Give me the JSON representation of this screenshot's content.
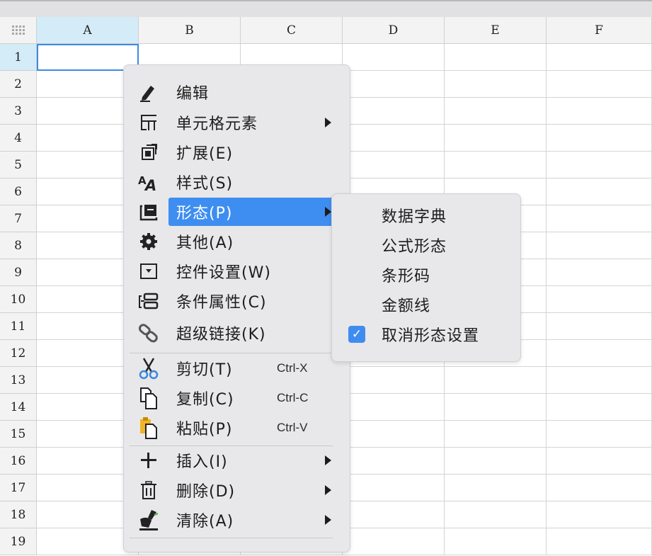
{
  "spreadsheet": {
    "columns": [
      "A",
      "B",
      "C",
      "D",
      "E",
      "F"
    ],
    "rows": [
      "1",
      "2",
      "3",
      "4",
      "5",
      "6",
      "7",
      "8",
      "9",
      "10",
      "11",
      "12",
      "13",
      "14",
      "15",
      "16",
      "17",
      "18",
      "19"
    ],
    "selected_cell": "A1"
  },
  "context_menu": {
    "items": [
      {
        "label": "编辑",
        "icon": "pencil-icon"
      },
      {
        "label": "单元格元素",
        "icon": "cell-element-icon",
        "submenu": true
      },
      {
        "label": "扩展(E)",
        "icon": "expand-icon"
      },
      {
        "label": "样式(S)",
        "icon": "style-icon"
      },
      {
        "label": "形态(P)",
        "icon": "form-icon",
        "submenu": true,
        "highlighted": true
      },
      {
        "label": "其他(A)",
        "icon": "gear-icon"
      },
      {
        "label": "控件设置(W)",
        "icon": "widget-icon"
      },
      {
        "label": "条件属性(C)",
        "icon": "condition-icon"
      },
      {
        "label": "超级链接(K)",
        "icon": "link-icon"
      },
      {
        "label": "剪切(T)",
        "icon": "cut-icon",
        "shortcut": "Ctrl-X"
      },
      {
        "label": "复制(C)",
        "icon": "copy-icon",
        "shortcut": "Ctrl-C"
      },
      {
        "label": "粘贴(P)",
        "icon": "paste-icon",
        "shortcut": "Ctrl-V"
      },
      {
        "label": "插入(I)",
        "icon": "plus-icon",
        "submenu": true
      },
      {
        "label": "删除(D)",
        "icon": "trash-icon",
        "submenu": true
      },
      {
        "label": "清除(A)",
        "icon": "eraser-icon",
        "submenu": true
      }
    ]
  },
  "form_submenu": {
    "items": [
      {
        "label": "数据字典",
        "checked": false
      },
      {
        "label": "公式形态",
        "checked": false
      },
      {
        "label": "条形码",
        "checked": false
      },
      {
        "label": "金额线",
        "checked": false
      },
      {
        "label": "取消形态设置",
        "checked": true
      }
    ],
    "check_mark": "✓"
  },
  "colors": {
    "highlight": "#3e8ef1",
    "selection_border": "#3b8ae6",
    "header_selected": "#d3ecf8"
  }
}
